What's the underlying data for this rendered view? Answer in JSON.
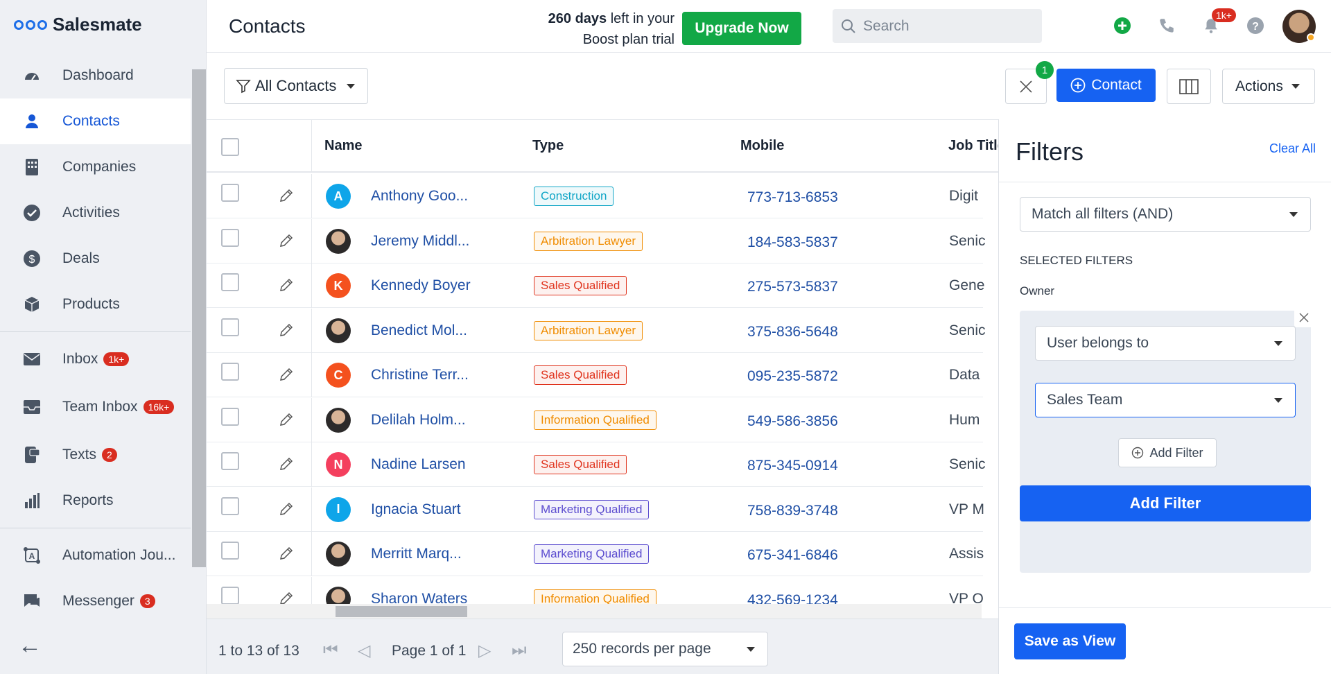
{
  "brand": {
    "name": "Salesmate",
    "color": "#1e6fe8"
  },
  "sidebar": {
    "items": [
      {
        "label": "Dashboard",
        "icon": "gauge-icon"
      },
      {
        "label": "Contacts",
        "icon": "person-icon",
        "active": true
      },
      {
        "label": "Companies",
        "icon": "building-icon"
      },
      {
        "label": "Activities",
        "icon": "check-circle-icon"
      },
      {
        "label": "Deals",
        "icon": "dollar-icon"
      },
      {
        "label": "Products",
        "icon": "cube-icon"
      },
      {
        "label": "Inbox",
        "icon": "mail-icon",
        "badge": "1k+"
      },
      {
        "label": "Team Inbox",
        "icon": "tray-icon",
        "badge": "16k+"
      },
      {
        "label": "Texts",
        "icon": "sms-icon",
        "badge": "2"
      },
      {
        "label": "Reports",
        "icon": "bar-chart-icon"
      },
      {
        "label": "Automation Jou...",
        "icon": "automation-icon"
      },
      {
        "label": "Messenger",
        "icon": "chat-icon",
        "badge": "3"
      }
    ],
    "back_icon": "arrow-left-icon"
  },
  "header": {
    "title": "Contacts",
    "trial_days": "260 days",
    "trial_rest": " left in your Boost plan trial",
    "upgrade_label": "Upgrade Now",
    "search_placeholder": "Search",
    "bell_badge": "1k+"
  },
  "toolbar": {
    "view_label": "All Contacts",
    "filter_count": "1",
    "contact_label": "Contact",
    "actions_label": "Actions"
  },
  "table": {
    "columns": [
      "Name",
      "Type",
      "Mobile",
      "Job Title"
    ],
    "rows": [
      {
        "initial": "A",
        "avatar_color": "#0ea5e9",
        "name": "Anthony Goo...",
        "type": "Construction",
        "tag_color": "#0ea5c6",
        "mobile": "773-713-6853",
        "job": "Digit"
      },
      {
        "initial": "",
        "photo": true,
        "name": "Jeremy Middl...",
        "type": "Arbitration Lawyer",
        "tag_color": "#f08c00",
        "mobile": "184-583-5837",
        "job": "Senic"
      },
      {
        "initial": "K",
        "avatar_color": "#f4511e",
        "name": "Kennedy Boyer",
        "type": "Sales Qualified",
        "tag_color": "#e0341e",
        "mobile": "275-573-5837",
        "job": "Gene"
      },
      {
        "initial": "",
        "photo": true,
        "name": "Benedict Mol...",
        "type": "Arbitration Lawyer",
        "tag_color": "#f08c00",
        "mobile": "375-836-5648",
        "job": "Senic"
      },
      {
        "initial": "C",
        "avatar_color": "#f4511e",
        "name": "Christine Terr...",
        "type": "Sales Qualified",
        "tag_color": "#e0341e",
        "mobile": "095-235-5872",
        "job": "Data"
      },
      {
        "initial": "",
        "photo": true,
        "name": "Delilah Holm...",
        "type": "Information Qualified",
        "tag_color": "#f08c00",
        "mobile": "549-586-3856",
        "job": "Hum"
      },
      {
        "initial": "N",
        "avatar_color": "#f43f5e",
        "name": "Nadine Larsen",
        "type": "Sales Qualified",
        "tag_color": "#e0341e",
        "mobile": "875-345-0914",
        "job": "Senic"
      },
      {
        "initial": "I",
        "avatar_color": "#0ea5e9",
        "name": "Ignacia Stuart",
        "type": "Marketing Qualified",
        "tag_color": "#5b4ccf",
        "mobile": "758-839-3748",
        "job": "VP M"
      },
      {
        "initial": "",
        "photo": true,
        "name": "Merritt Marq...",
        "type": "Marketing Qualified",
        "tag_color": "#5b4ccf",
        "mobile": "675-341-6846",
        "job": "Assis"
      },
      {
        "initial": "",
        "photo": true,
        "name": "Sharon Waters",
        "type": "Information Qualified",
        "tag_color": "#f08c00",
        "mobile": "432-569-1234",
        "job": "VP O"
      }
    ]
  },
  "footer": {
    "count": "1 to 13 of 13",
    "page": "Page 1 of 1",
    "per_page": "250 records per page"
  },
  "filters": {
    "title": "Filters",
    "clear_all": "Clear All",
    "match": "Match all filters (AND)",
    "section": "SELECTED FILTERS",
    "field_label": "Owner",
    "operator": "User belongs to",
    "value": "Sales Team",
    "add_filter_small": "Add Filter",
    "add_filter_big": "Add Filter",
    "save_view": "Save as View"
  }
}
